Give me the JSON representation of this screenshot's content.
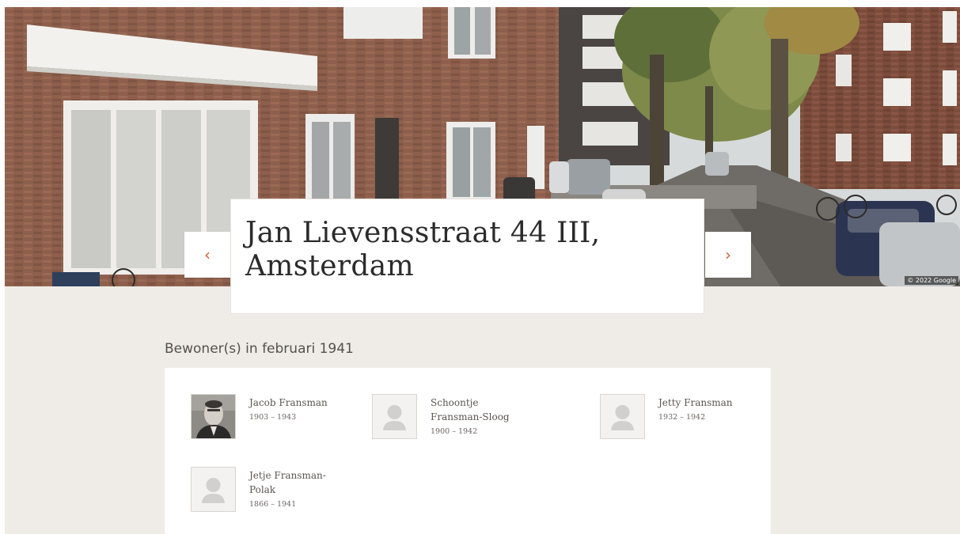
{
  "address": {
    "title_line1": "Jan Lievensstraat 44 III,",
    "title_line2": "Amsterdam"
  },
  "hero": {
    "attribution": "© 2022 Google",
    "prev_label": "‹",
    "next_label": "›"
  },
  "residents": {
    "heading": "Bewoner(s) in februari 1941",
    "people": [
      {
        "name": "Jacob Fransman",
        "years": "1903 – 1943",
        "photo": "portrait-photo"
      },
      {
        "name": "Schoontje Fransman-Sloog",
        "years": "1900 – 1942",
        "photo": "person-placeholder-icon"
      },
      {
        "name": "Jetty Fransman",
        "years": "1932 – 1942",
        "photo": "person-placeholder-icon"
      },
      {
        "name": "Jetje Fransman-Polak",
        "years": "1866 – 1941",
        "photo": "person-placeholder-icon"
      }
    ]
  },
  "colors": {
    "accent": "#c8643d",
    "band_background": "#efece8",
    "card_background": "#ffffff"
  }
}
